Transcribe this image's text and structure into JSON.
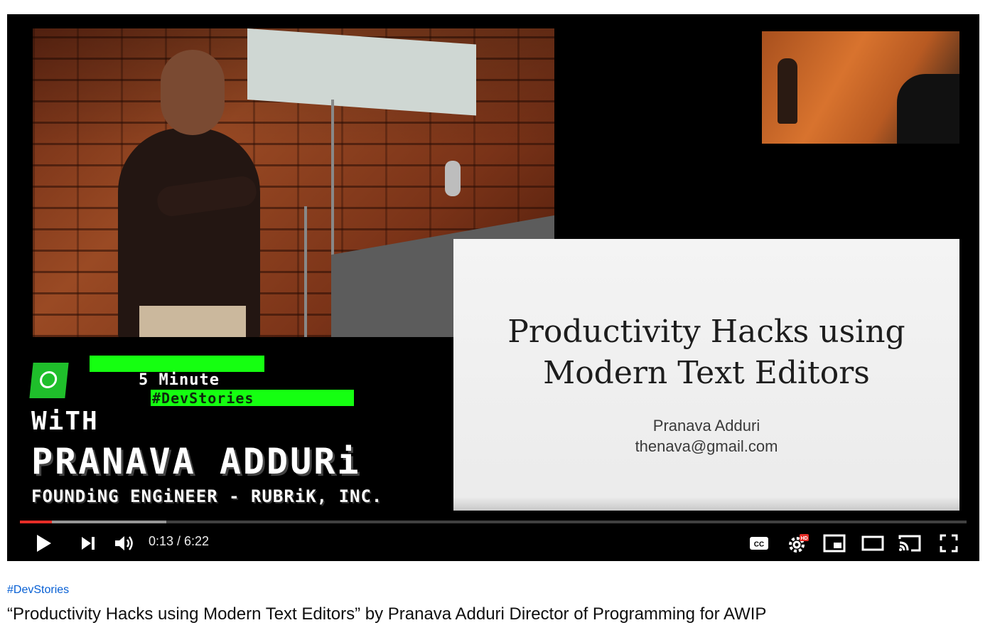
{
  "slide": {
    "title": "Productivity Hacks using\nModern Text Editors",
    "author": "Pranava Adduri",
    "email": "thenava@gmail.com"
  },
  "overlay": {
    "five_minute": "5 Minute",
    "devstories": "#DevStories",
    "with": "WiTH",
    "name": "PRANAVA ADDURi",
    "role": "FOUNDiNG ENGiNEER - RUBRiK, INC."
  },
  "controls": {
    "time_current": "0:13",
    "time_total": "6:22",
    "time_display": "0:13 / 6:22",
    "progress_fraction": 0.034,
    "buffered_fraction": 0.155,
    "accent_color": "#e52d27",
    "icons": [
      "play-icon",
      "next-icon",
      "volume-icon",
      "captions-icon",
      "settings-hd-icon",
      "miniplayer-icon",
      "theater-mode-icon",
      "cast-icon",
      "fullscreen-icon"
    ]
  },
  "video": {
    "hashtag": "#DevStories",
    "title": "“Productivity Hacks using Modern Text Editors” by Pranava Adduri Director of Programming for AWIP"
  }
}
